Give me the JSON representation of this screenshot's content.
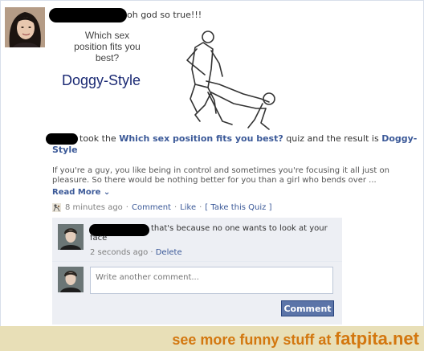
{
  "post": {
    "status_text": "oh god so true!!!",
    "quiz_question": "Which sex position fits you best?",
    "quiz_answer": "Doggy-Style"
  },
  "story": {
    "took_text": "took the",
    "quiz_link": "Which sex position fits you best?",
    "result_text": "quiz and the result is",
    "result_link": "Doggy-Style",
    "description": "If you're a guy, you like being in control and sometimes you're focusing it all just on pleasure. So there would be nothing better for you than a girl who bends over ...",
    "read_more": "Read More",
    "read_more_icon": "chevron-down",
    "time": "8 minutes ago",
    "comment_link": "Comment",
    "like_link": "Like",
    "take_quiz_link": "[ Take this Quiz ]"
  },
  "comments": [
    {
      "text": "that's because no one wants to look at your face",
      "time": "2 seconds ago",
      "delete": "Delete"
    }
  ],
  "composer": {
    "placeholder": "Write another comment...",
    "button": "Comment"
  },
  "footer": {
    "prefix": "see more funny stuff at",
    "site": "fatpita.net",
    "color": "#d3770f"
  }
}
